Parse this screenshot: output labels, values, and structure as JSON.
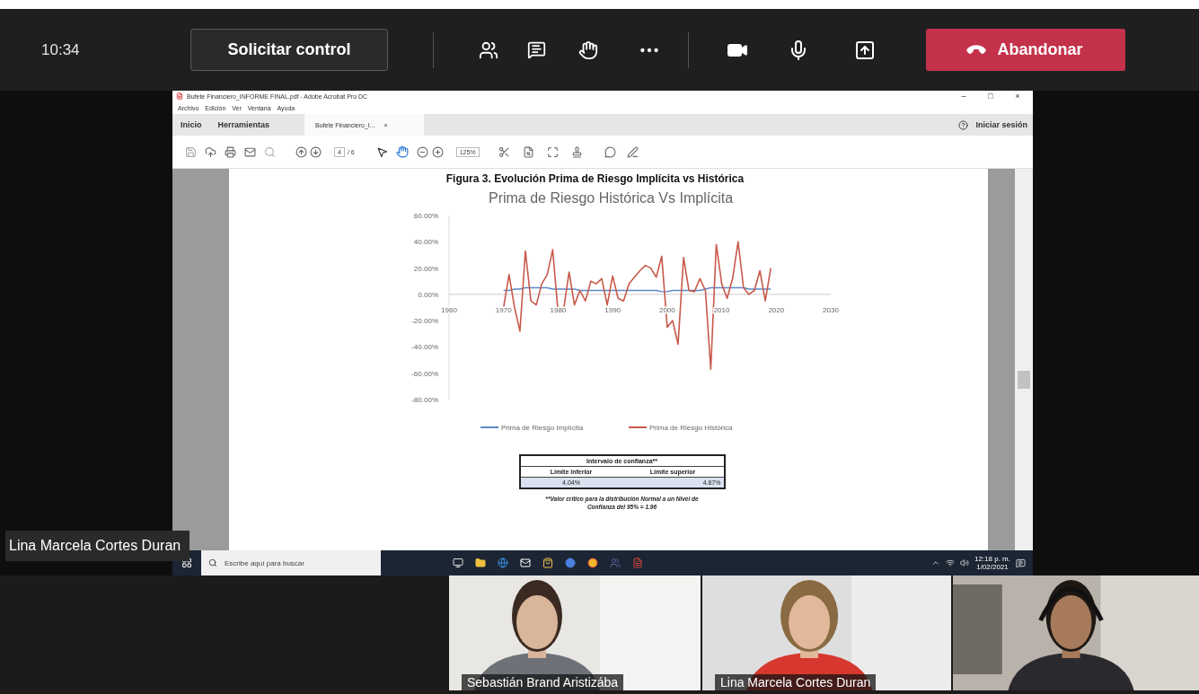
{
  "top_bar": {
    "time": "10:34",
    "request_button": "Solicitar control",
    "leave_button": "Abandonar"
  },
  "shared_screen": {
    "presenter": "Lina Marcela Cortes Duran",
    "window": {
      "title": "Bufete Financiero_INFORME FINAL.pdf - Adobe Acrobat Pro DC",
      "controls": [
        "–",
        "□",
        "×"
      ]
    },
    "menu": [
      "Archivo",
      "Edición",
      "Ver",
      "Ventana",
      "Ayuda"
    ],
    "tabs": [
      {
        "label": "Inicio",
        "selected": false
      },
      {
        "label": "Herramientas",
        "selected": false
      },
      {
        "label": "Bufete Financiero_I...",
        "selected": true,
        "close": "×"
      }
    ],
    "sign_in": "Iniciar sesión",
    "toolbar": {
      "page": "4",
      "page_count": "/ 6",
      "zoom": "125%"
    },
    "document": {
      "figure_title": "Figura 3. Evolución Prima de Riesgo Implícita vs Histórica",
      "chart_data": {
        "type": "line",
        "title": "Prima de Riesgo Histórica Vs Implícita",
        "x": [
          1970,
          1971,
          1972,
          1973,
          1974,
          1975,
          1976,
          1977,
          1978,
          1979,
          1980,
          1981,
          1982,
          1983,
          1984,
          1985,
          1986,
          1987,
          1988,
          1989,
          1990,
          1991,
          1992,
          1993,
          1994,
          1995,
          1996,
          1997,
          1998,
          1999,
          2000,
          2001,
          2002,
          2003,
          2004,
          2005,
          2006,
          2007,
          2008,
          2009,
          2010,
          2011,
          2012,
          2013,
          2014,
          2015,
          2016,
          2017,
          2018,
          2019
        ],
        "series": [
          {
            "name": "Prima de Riesgo Implícita",
            "color": "#5b87c9",
            "values": [
              3,
              3,
              4,
              4,
              5,
              5,
              5,
              5,
              5,
              4,
              4,
              4,
              4,
              4,
              3,
              3,
              3,
              3,
              3,
              3,
              3,
              3,
              3,
              3,
              3,
              3,
              3,
              3,
              3,
              2,
              2,
              3,
              3,
              3,
              3,
              3,
              3,
              4,
              5,
              5,
              5,
              5,
              5,
              5,
              5,
              4,
              4,
              4,
              4,
              4
            ]
          },
          {
            "name": "Prima de Riesgo Histórica",
            "color": "#c9594a",
            "values": [
              -10,
              15,
              -10,
              -28,
              33,
              -5,
              -8,
              8,
              15,
              34,
              -14,
              -12,
              17,
              -8,
              3,
              -5,
              10,
              8,
              12,
              -8,
              14,
              -3,
              -5,
              8,
              13,
              18,
              22,
              20,
              13,
              29,
              -25,
              -20,
              -38,
              28,
              3,
              2,
              12,
              3,
              -57,
              38,
              8,
              -3,
              12,
              40,
              5,
              0,
              3,
              18,
              -5,
              20
            ]
          }
        ],
        "legend": "bottom",
        "xlim": [
          1960,
          2030
        ],
        "ylim": [
          -80,
          60
        ],
        "xticks": [
          1960,
          1970,
          1980,
          1990,
          2000,
          2010,
          2020,
          2030
        ],
        "yticks": [
          {
            "value": 60,
            "label": "60.00%"
          },
          {
            "value": 40,
            "label": "40.00%"
          },
          {
            "value": 20,
            "label": "20.00%"
          },
          {
            "value": 0,
            "label": "0.00%"
          },
          {
            "value": -20,
            "label": "-20.00%"
          },
          {
            "value": -40,
            "label": "-40.00%"
          },
          {
            "value": -60,
            "label": "-60.00%"
          },
          {
            "value": -80,
            "label": "-80.00%"
          }
        ]
      },
      "interval_table": {
        "title": "Intervalo de confianza**",
        "columns": [
          "Límite inferior",
          "Límite superior"
        ],
        "values": [
          "4.04%",
          "4.67%"
        ]
      },
      "note": "**Valor crítico para la distribución Normal a un Nivel de Confianza del 95% = 1.96"
    },
    "taskbar": {
      "search": {
        "placeholder": "Escribe aquí para buscar"
      },
      "time": "12:18 p. m.",
      "date": "1/02/2021"
    }
  },
  "video_tiles": [
    {
      "kind": "picture",
      "name": "Sebastián Brand Aristizába"
    },
    {
      "kind": "picture",
      "name": "Lina Marcela Cortes Duran"
    },
    {
      "kind": "picture"
    }
  ]
}
